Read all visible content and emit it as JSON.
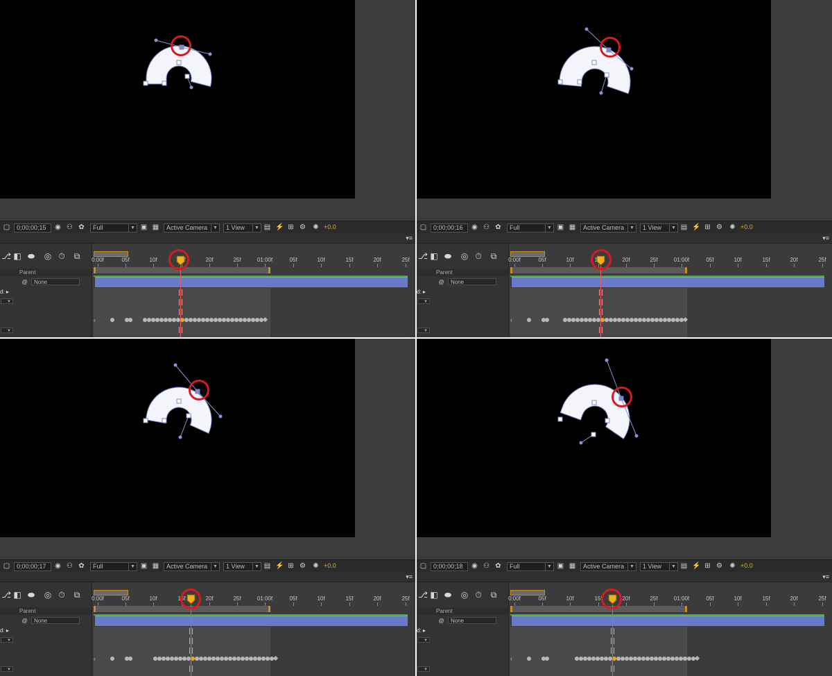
{
  "panels": [
    {
      "id": "tl",
      "timecode": "0;00;00;15"
    },
    {
      "id": "tr",
      "timecode": "0;00;00;16"
    },
    {
      "id": "bl",
      "timecode": "0;00;00;17"
    },
    {
      "id": "br",
      "timecode": "0;00;00;18"
    }
  ],
  "viewer_bar": {
    "resolution": "Full",
    "camera": "Active Camera",
    "views": "1 View",
    "exposure": "+0.0"
  },
  "timeline": {
    "parent_label": "Parent",
    "parent_value": "None",
    "ruler_labels": [
      "0:00f",
      "05f",
      "10f",
      "15f",
      "20f",
      "25f",
      "01:00f",
      "05f",
      "10f",
      "15f",
      "20f",
      "25f"
    ],
    "row_label": "d:"
  },
  "colors": {
    "highlight": "#d51a23",
    "layer_bar": "#6a79c9",
    "keyframe_active": "#e8a51b"
  },
  "icons": [
    "comp-flowchart-icon",
    "draft-3d-icon",
    "motion-blur-icon",
    "graph-editor-icon",
    "snapshot-icon",
    "stopwatch-icon"
  ]
}
